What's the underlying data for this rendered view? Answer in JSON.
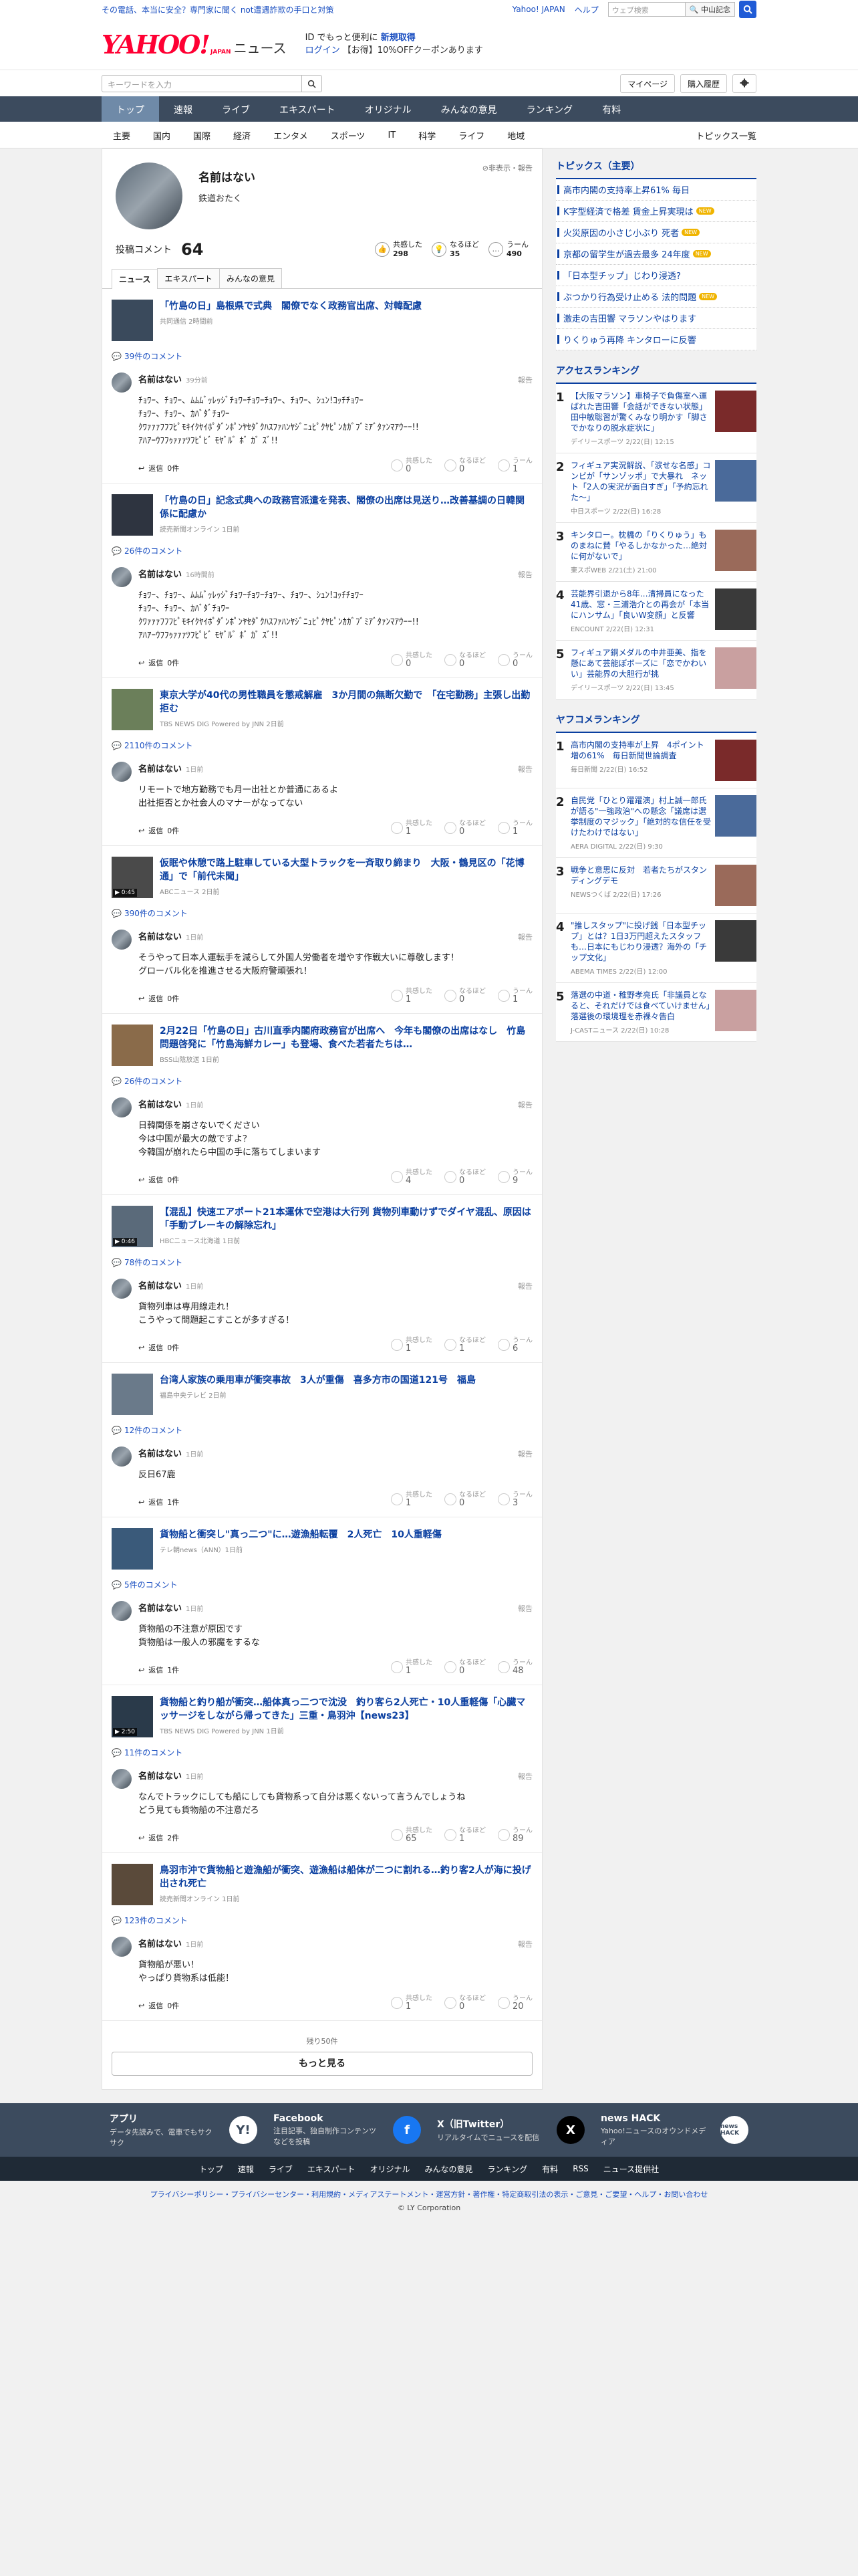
{
  "topbar": {
    "promo": "その電話、本当に安全？専門家に聞く not遭遇詐欺の手口と対策",
    "links": [
      "Yahoo! JAPAN",
      "ヘルプ"
    ],
    "search_placeholder": "ウェブ検索",
    "search_btn": "中山記念"
  },
  "header": {
    "logo_main": "YAHOO!",
    "logo_sub": "JAPAN",
    "logo_news": "ニュース",
    "msg1_pre": "ID でもっと便利に",
    "msg1_link": "新規取得",
    "msg2_login": "ログイン",
    "msg2_rest": "【お得】10%OFFクーポンあります"
  },
  "searchrow": {
    "placeholder": "キーワードを入力",
    "mypage": "マイページ",
    "history": "購入履歴"
  },
  "mainnav": [
    "トップ",
    "速報",
    "ライブ",
    "エキスパート",
    "オリジナル",
    "みんなの意見",
    "ランキング",
    "有料"
  ],
  "subnav": [
    "主要",
    "国内",
    "国際",
    "経済",
    "エンタメ",
    "スポーツ",
    "IT",
    "科学",
    "ライフ",
    "地域"
  ],
  "subnav_more": "トピックス一覧",
  "profile": {
    "name": "名前はない",
    "sub": "鉄道おたく",
    "report": "非表示・報告",
    "posts_label": "投稿コメント",
    "posts_count": "64",
    "reacts": [
      {
        "label": "共感した",
        "count": "298",
        "icon": "thumb-icon"
      },
      {
        "label": "なるほど",
        "count": "35",
        "icon": "bulb-icon"
      },
      {
        "label": "うーん",
        "count": "490",
        "icon": "hmm-icon"
      }
    ]
  },
  "tabs": [
    "ニュース",
    "エキスパート",
    "みんなの意見"
  ],
  "reply_label": "返信",
  "report_label": "報告",
  "react_labels": [
    "共感した",
    "なるほど",
    "うーん"
  ],
  "entries": [
    {
      "title": "「竹島の日」島根県で式典　閣僚でなく政務官出席、対韓配慮",
      "source": "共同通信 2時間前",
      "comments": "39件のコメント",
      "author": "名前はない",
      "time": "39分前",
      "body": "ﾁｮﾜｰ、ﾁｮﾜｰ、ﾑﾑﾑﾞｯﾚｯｼﾞﾁｮﾜｰﾁｮﾜｰﾁｮﾜｰ、ﾁｮﾜｰ、ｼｭﾝ!ｺｯﾁﾁｮﾜｰ\nﾁｮﾜｰ、ﾁｮﾜｰ、ｶﾊﾞﾀﾞﾁｮﾜｰ\nｸﾜｧｧｧﾌﾌﾌﾋﾟﾓｷｲｸﾔｲﾎﾟﾀﾞﾝﾎﾟﾝﾔｾﾀﾞｸﾊｽﾌｧﾊﾝﾔｼﾞﾆｭﾋﾟｸﾔﾋﾟﾝｶｶﾞﾌﾞﾐｱﾞﾀｧﾝﾏｱｳｰｰ!!\nｱﾊｱｰｳﾌﾌｩｧｧｧﾂﾌﾋﾟﾋﾞ ﾓﾔﾞﾙﾞ ﾎﾞ ｶﾞ ｽﾞ!!",
      "replies": "0件",
      "r": [
        "0",
        "0",
        "1"
      ]
    },
    {
      "title": "「竹島の日」記念式典への政務官派遣を発表、閣僚の出席は見送り…改善基調の日韓関係に配慮か",
      "source": "読売新聞オンライン 1日前",
      "comments": "26件のコメント",
      "author": "名前はない",
      "time": "16時間前",
      "body": "ﾁｮﾜｰ、ﾁｮﾜｰ、ﾑﾑﾑﾞｯﾚｯｼﾞﾁｮﾜｰﾁｮﾜｰﾁｮﾜｰ、ﾁｮﾜｰ、ｼｭﾝ!ｺｯﾁﾁｮﾜｰ\nﾁｮﾜｰ、ﾁｮﾜｰ、ｶﾊﾞﾀﾞﾁｮﾜｰ\nｸﾜｧｧｧﾌﾌﾌﾋﾟﾓｷｲｸﾔｲﾎﾟﾀﾞﾝﾎﾟﾝﾔｾﾀﾞｸﾊｽﾌｧﾊﾝﾔｼﾞﾆｭﾋﾟｸﾔﾋﾟﾝｶｶﾞﾌﾞﾐｱﾞﾀｧﾝﾏｱｳｰｰ!!\nｱﾊｱｰｳﾌﾌｩｧｧｧﾂﾌﾋﾟﾋﾞ ﾓﾔﾞﾙﾞ ﾎﾞ ｶﾞ ｽﾞ!!",
      "replies": "0件",
      "r": [
        "0",
        "0",
        "0"
      ]
    },
    {
      "title": "東京大学が40代の男性職員を懲戒解雇　3か月間の無断欠勤で　「在宅勤務」主張し出勤拒む",
      "source": "TBS NEWS DIG Powered by JNN 2日前",
      "comments": "2110件のコメント",
      "author": "名前はない",
      "time": "1日前",
      "body": "リモートで地方勤務でも月一出社とか普通にあるよ\n出社拒否とか社会人のマナーがなってない",
      "replies": "0件",
      "r": [
        "1",
        "0",
        "1"
      ]
    },
    {
      "title": "仮眠や休憩で路上駐車している大型トラックを一斉取り締まり　大阪・鶴見区の「花博通」で「前代未聞」",
      "source": "ABCニュース 2日前",
      "duration": "▶ 0:45",
      "comments": "390件のコメント",
      "author": "名前はない",
      "time": "1日前",
      "body": "そうやって日本人運転手を減らして外国人労働者を増やす作戦大いに尊敬します！\nグローバル化を推進させる大阪府警頑張れ！",
      "replies": "0件",
      "r": [
        "1",
        "0",
        "1"
      ]
    },
    {
      "title": "2月22日「竹島の日」古川直季内閣府政務官が出席へ　今年も閣僚の出席はなし　竹島問題啓発に「竹島海鮮カレー」も登場、食べた若者たちは…",
      "source": "BSS山陰放送 1日前",
      "comments": "26件のコメント",
      "author": "名前はない",
      "time": "1日前",
      "body": "日韓関係を崩さないでください\n今は中国が最大の敵ですよ？\n今韓国が崩れたら中国の手に落ちてしまいます",
      "replies": "0件",
      "r": [
        "4",
        "0",
        "9"
      ]
    },
    {
      "title": "【混乱】快速エアポート21本運休で空港は大行列 貨物列車動けずでダイヤ混乱、原因は「手動ブレーキの解除忘れ」",
      "source": "HBCニュース北海道 1日前",
      "duration": "▶ 0:46",
      "comments": "78件のコメント",
      "author": "名前はない",
      "time": "1日前",
      "body": "貨物列車は専用線走れ！\nこうやって問題起こすことが多すぎる！",
      "replies": "0件",
      "r": [
        "1",
        "1",
        "6"
      ]
    },
    {
      "title": "台湾人家族の乗用車が衝突事故　3人が重傷　喜多方市の国道121号　福島",
      "source": "福島中央テレビ 2日前",
      "comments": "12件のコメント",
      "author": "名前はない",
      "time": "1日前",
      "body": "反日67鹿",
      "replies": "1件",
      "r": [
        "1",
        "0",
        "3"
      ]
    },
    {
      "title": "貨物船と衝突し\"真っ二つ\"に…遊漁船転覆　2人死亡　10人重軽傷",
      "source": "テレ朝news（ANN）1日前",
      "comments": "5件のコメント",
      "author": "名前はない",
      "time": "1日前",
      "body": "貨物船の不注意が原因です\n貨物船は一般人の邪魔をするな",
      "replies": "1件",
      "r": [
        "1",
        "0",
        "48"
      ]
    },
    {
      "title": "貨物船と釣り船が衝突…船体真っ二つで沈没　釣り客ら2人死亡・10人重軽傷「心臓マッサージをしながら帰ってきた」三重・鳥羽沖【news23】",
      "source": "TBS NEWS DIG Powered by JNN 1日前",
      "duration": "▶ 2:50",
      "comments": "11件のコメント",
      "author": "名前はない",
      "time": "1日前",
      "body": "なんでトラックにしても船にしても貨物系って自分は悪くないって言うんでしょうね\nどう見ても貨物船の不注意だろ",
      "replies": "2件",
      "r": [
        "65",
        "1",
        "89"
      ]
    },
    {
      "title": "鳥羽市沖で貨物船と遊漁船が衝突、遊漁船は船体が二つに割れる…釣り客2人が海に投げ出され死亡",
      "source": "読売新聞オンライン 1日前",
      "comments": "123件のコメント",
      "author": "名前はない",
      "time": "1日前",
      "body": "貨物船が悪い！\nやっぱり貨物系は低能！",
      "replies": "0件",
      "r": [
        "1",
        "0",
        "20"
      ]
    }
  ],
  "feed_footer": {
    "remain": "残り50件",
    "more": "もっと見る"
  },
  "side": {
    "topics_title": "トピックス（主要）",
    "topics": [
      {
        "text": "高市内閣の支持率上昇61% 毎日",
        "new": ""
      },
      {
        "text": "K字型経済で格差 賃金上昇実現は",
        "new": "NEW"
      },
      {
        "text": "火災原因の小さじ小ぶり 死者",
        "new": "NEW"
      },
      {
        "text": "京都の留学生が過去最多 24年度",
        "new": "NEW"
      },
      {
        "text": "「日本型チップ」じわり浸透?",
        "new": ""
      },
      {
        "text": "ぶつかり行為受け止める 法的問題",
        "new": "NEW"
      },
      {
        "text": "激走の吉田響 マラソンやはります",
        "new": ""
      },
      {
        "text": "りくりゅう再降 キンタローに反響",
        "new": ""
      }
    ],
    "access_title": "アクセスランキング",
    "access": [
      {
        "no": "1",
        "title": "【大阪マラソン】車椅子で負傷室へ運ばれた吉田響「会話ができない状態」田中敏聡習が驚くみなり明かす「脚さでかなりの脱水症状に」",
        "src": "デイリースポーツ 2/22(日) 12:15"
      },
      {
        "no": "2",
        "title": "フィギュア実況解説、「涙せな名感」コンビが「サンゾッポ」で大暴れ　ネット「2人の実況が面白すぎ」「予約忘れた～」",
        "src": "中日スポーツ 2/22(日) 16:28"
      },
      {
        "no": "3",
        "title": "キンタロー。枕橋の「りくりゅう」ものまねに賛「やるしかなかった…絶対に何がないで」",
        "src": "東スポWEB 2/21(土) 21:00"
      },
      {
        "no": "4",
        "title": "芸能界引退から8年…清掃員になった41歳、窓・三浦浩介との再会が「本当にハンサム」「良いW変顔」と反響",
        "src": "ENCOUNT 2/22(日) 12:31"
      },
      {
        "no": "5",
        "title": "フィギュア銅メダルの中井亜美、指を懸にあて芸能ぽボーズに「恋でかわいい」芸能界の大胆行が挑",
        "src": "デイリースポーツ 2/22(日) 13:45"
      }
    ],
    "yafuko_title": "ヤフコメランキング",
    "yafuko": [
      {
        "no": "1",
        "title": "高市内閣の支持率が上昇　4ポイント増の61%　毎日新聞世論調査",
        "src": "毎日新聞 2/22(日) 16:52"
      },
      {
        "no": "2",
        "title": "自民党「ひとり躍躍演」村上誠一郎氏が語る\"一強政治\"への懸念「議席は選挙制度のマジック」「絶対的な信任を受けたわけではない」",
        "src": "AERA DIGITAL 2/22(日) 9:30"
      },
      {
        "no": "3",
        "title": "戦争と意思に反対　若者たちがスタンディングデモ",
        "src": "NEWSつくば 2/22(日) 17:26"
      },
      {
        "no": "4",
        "title": "\"推しスタップ\"に投げ銭「日本型チップ」とは？1日3万円超えたスタッフも…日本にもじわり浸透？海外の「チップ文化」",
        "src": "ABEMA TIMES 2/22(日) 12:00"
      },
      {
        "no": "5",
        "title": "落選の中道・稚野孝亮氏「非議員となると、それだけでは食べていけません」落選後の環境理を赤裸々告白",
        "src": "J-CASTニュース 2/22(日) 10:28"
      }
    ]
  },
  "footer": {
    "apps": [
      {
        "title": "アプリ",
        "desc": "データ先読みで、電車でもサクサク",
        "icon": "Y!"
      },
      {
        "title": "Facebook",
        "desc": "注目記事、独自制作コンテンツなどを投稿",
        "icon": "f"
      },
      {
        "title": "X（旧Twitter）",
        "desc": "リアルタイムでニュースを配信",
        "icon": "X"
      },
      {
        "title": "news HACK",
        "desc": "Yahoo!ニュースのオウンドメディア",
        "icon": "news HACK"
      }
    ],
    "links": [
      "トップ",
      "速報",
      "ライブ",
      "エキスパート",
      "オリジナル",
      "みんなの意見",
      "ランキング",
      "有料",
      "RSS",
      "ニュース提供社"
    ],
    "bottom": "プライバシーポリシー・プライバシーセンター・利用規約・メディアステートメント・運営方針・著作権・特定商取引法の表示・ご意見・ご要望・ヘルプ・お問い合わせ",
    "copyright": "© LY Corporation"
  },
  "colors": {
    "nav_bg": "#3c4b5e",
    "link_blue": "#0a3fa0",
    "brand_red": "#ff0033"
  }
}
